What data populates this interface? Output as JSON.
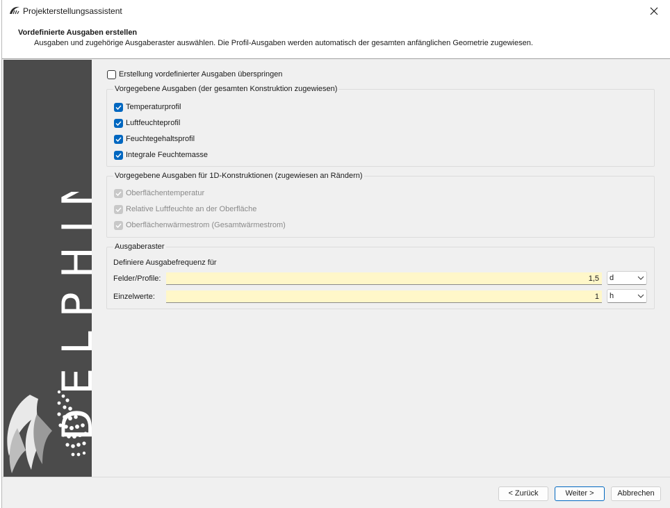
{
  "window": {
    "title": "Projekterstellungsassistent"
  },
  "header": {
    "title": "Vordefinierte Ausgaben erstellen",
    "subtitle": "Ausgaben und zugehörige Ausgaberaster auswählen. Die Profil-Ausgaben werden automatisch der gesamten anfänglichen Geometrie zugewiesen."
  },
  "sidebar": {
    "brand": "DELPHIN"
  },
  "skip": {
    "label": "Erstellung vordefinierter Ausgaben überspringen",
    "checked": false
  },
  "group_predefined": {
    "title": "Vorgegebene Ausgaben (der gesamten Konstruktion zugewiesen)",
    "items": [
      {
        "label": "Temperaturprofil",
        "checked": true
      },
      {
        "label": "Luftfeuchteprofil",
        "checked": true
      },
      {
        "label": "Feuchtegehaltsprofil",
        "checked": true
      },
      {
        "label": "Integrale Feuchtemasse",
        "checked": true
      }
    ]
  },
  "group_1d": {
    "title": "Vorgegebene Ausgaben für 1D-Konstruktionen (zugewiesen an Rändern)",
    "items": [
      {
        "label": "Oberflächentemperatur",
        "checked": true,
        "disabled": true
      },
      {
        "label": "Relative Luftfeuchte an der Oberfläche",
        "checked": true,
        "disabled": true
      },
      {
        "label": "Oberflächenwärmestrom (Gesamtwärmestrom)",
        "checked": true,
        "disabled": true
      }
    ]
  },
  "group_grid": {
    "title": "Ausgaberaster",
    "description": "Definiere Ausgabefrequenz für",
    "fields_label": "Felder/Profile:",
    "fields_value": "1,5",
    "fields_unit": "d",
    "single_label": "Einzelwerte:",
    "single_value": "1",
    "single_unit": "h"
  },
  "buttons": {
    "back": "< Zurück",
    "next": "Weiter >",
    "cancel": "Abbrechen"
  },
  "colors": {
    "accent": "#0067c0",
    "sidebar": "#4b4b4b",
    "field_bg": "#fff7c9"
  }
}
